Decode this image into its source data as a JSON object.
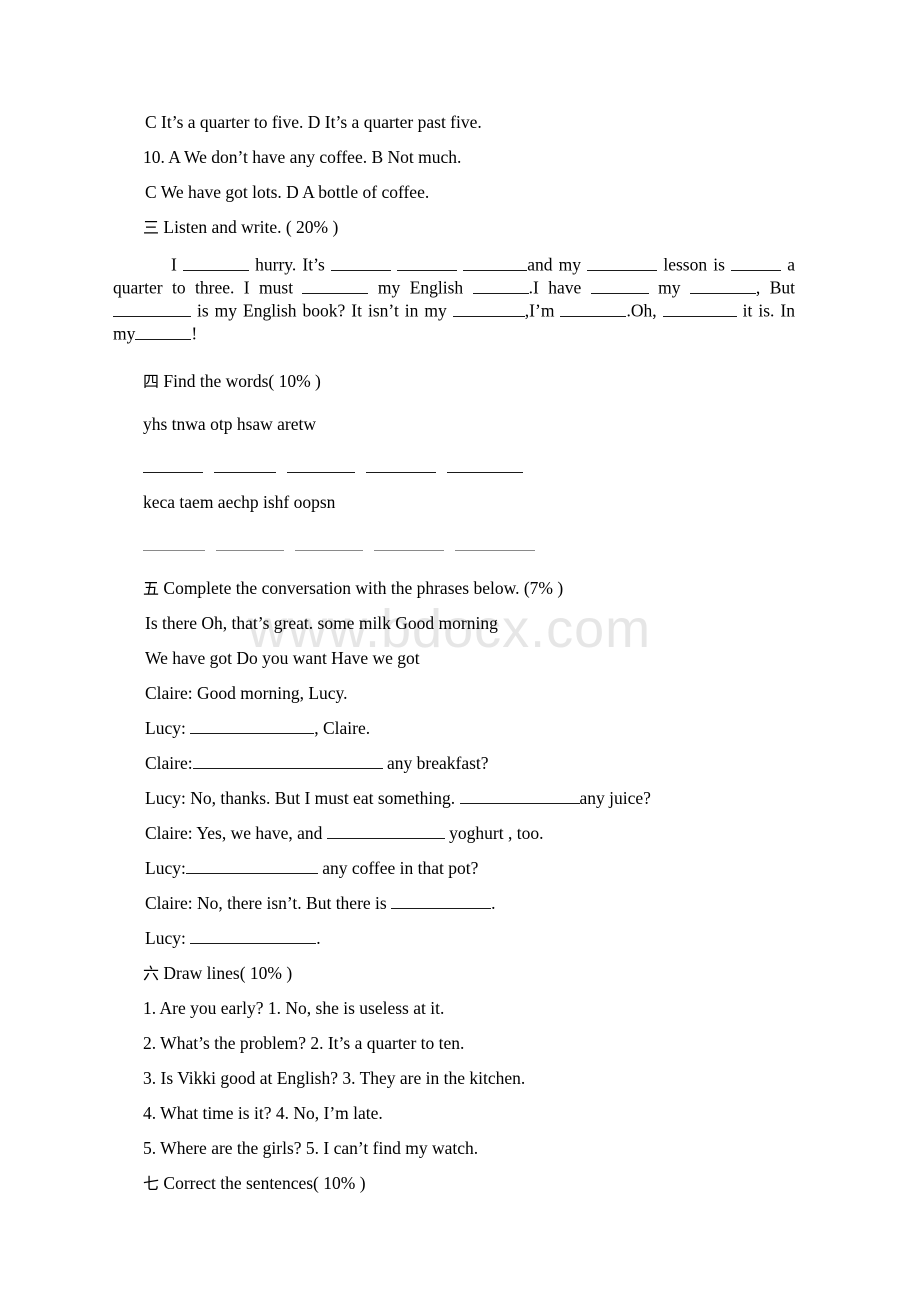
{
  "watermark": {
    "text": "www.bdocx.com"
  },
  "listening_options": {
    "line_q9_cd": "C It’s a quarter to five. D It’s a quarter past five.",
    "line_q10_ab": "10. A We don’t have any coffee. B Not much.",
    "line_q10_cd": "C We have got lots. D A bottle of coffee."
  },
  "section3": {
    "numeral": "三",
    "heading": "Listen and write. ( 20% )",
    "paragraph_parts": [
      "I ",
      " hurry. It’s ",
      " ",
      " ",
      "and my ",
      " lesson is ",
      " a quarter to three. I must ",
      " my English ",
      ".I have ",
      " my ",
      ", But ",
      " is my English book? It isn’t in my ",
      ",I’m ",
      ".Oh, ",
      " it is. In my",
      "!"
    ]
  },
  "section4": {
    "numeral": "四",
    "heading": "Find the words( 10% )",
    "row1_words": "yhs tnwa otp hsaw aretw",
    "row2_words": "keca taem aechp ishf oopsn",
    "blank_count": 5
  },
  "section5": {
    "numeral": "五",
    "heading": "Complete the conversation with the phrases below. (7% )",
    "phrases_line1": "Is there Oh, that’s great. some milk Good morning",
    "phrases_line2": "We have got Do you want Have we got",
    "dialogue": [
      {
        "speaker": "Claire:",
        "before": " Good morning, Lucy.",
        "blank": false,
        "after": ""
      },
      {
        "speaker": "Lucy:",
        "before": " ",
        "blank": true,
        "after": ", Claire."
      },
      {
        "speaker": "Claire:",
        "before": "",
        "blank": true,
        "after": " any breakfast?"
      },
      {
        "speaker": "Lucy:",
        "before": " No, thanks. But I must eat something. ",
        "blank": true,
        "after": "any juice?"
      },
      {
        "speaker": "Claire:",
        "before": " Yes, we have, and ",
        "blank": true,
        "after": " yoghurt , too."
      },
      {
        "speaker": "Lucy:",
        "before": "",
        "blank": true,
        "after": " any coffee in that pot?"
      },
      {
        "speaker": "Claire:",
        "before": " No, there isn’t. But there is ",
        "blank": true,
        "after": "."
      },
      {
        "speaker": "Lucy:",
        "before": " ",
        "blank": true,
        "after": "."
      }
    ]
  },
  "section6": {
    "numeral": "六",
    "heading": "Draw lines( 10% )",
    "items": [
      "1. Are you early? 1. No, she is useless at it.",
      "2. What’s the problem? 2. It’s a quarter to ten.",
      "3. Is Vikki good at English? 3. They are in the kitchen.",
      "4. What time is it? 4. No, I’m late.",
      "5. Where are the girls? 5. I can’t find my watch."
    ]
  },
  "section7": {
    "numeral": "七",
    "heading": "Correct the sentences( 10% )"
  }
}
